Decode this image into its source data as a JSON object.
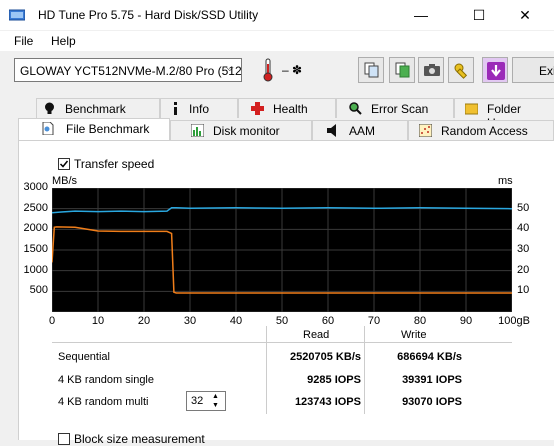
{
  "window": {
    "title": "HD Tune Pro 5.75 - Hard Disk/SSD Utility",
    "minimize": "—",
    "maximize": "☐",
    "close": "✕"
  },
  "menu": {
    "items": [
      "File",
      "Help"
    ]
  },
  "toolbar": {
    "drive": "GLOWAY YCT512NVMe-M.2/80 Pro (512",
    "temperature": "– ✽",
    "exit_label": "Exi"
  },
  "tabs_row1": [
    "Benchmark",
    "Info",
    "Health",
    "Error Scan",
    "Folder Usage"
  ],
  "tabs_row2": [
    "File Benchmark",
    "Disk monitor",
    "AAM",
    "Random Access"
  ],
  "transfer_speed_label": "Transfer speed",
  "chart_data": {
    "type": "line",
    "left_unit": "MB/s",
    "right_unit": "ms",
    "y_left_ticks": [
      "3000",
      "2500",
      "2000",
      "1500",
      "1000",
      "500"
    ],
    "y_right_ticks": [
      "50",
      "40",
      "30",
      "20",
      "10"
    ],
    "x_ticks": [
      "0",
      "10",
      "20",
      "30",
      "40",
      "50",
      "60",
      "70",
      "80",
      "90",
      "100gB"
    ],
    "ylim_left": [
      0,
      3000
    ],
    "ylim_right": [
      0,
      60
    ],
    "xlim": [
      0,
      100
    ],
    "grid": true,
    "series": [
      {
        "color": "#2aa8e0",
        "axis": "left",
        "x": [
          0,
          2,
          5,
          10,
          15,
          20,
          25,
          26,
          27,
          30,
          40,
          50,
          60,
          70,
          80,
          90,
          100
        ],
        "y": [
          2400,
          2420,
          2440,
          2430,
          2440,
          2430,
          2440,
          2520,
          2520,
          2510,
          2520,
          2510,
          2520,
          2510,
          2520,
          2510,
          2500
        ]
      },
      {
        "color": "#f07e1a",
        "axis": "left",
        "x": [
          0,
          0.5,
          1,
          5,
          10,
          15,
          20,
          25,
          26,
          26.5,
          27,
          30,
          40,
          50,
          60,
          70,
          80,
          90,
          100
        ],
        "y": [
          1200,
          2050,
          2060,
          2050,
          1960,
          1950,
          1950,
          1950,
          1900,
          480,
          460,
          460,
          460,
          460,
          460,
          460,
          460,
          460,
          460
        ]
      }
    ]
  },
  "results": {
    "read_header": "Read",
    "write_header": "Write",
    "rows": [
      {
        "label": "Sequential",
        "read": "2520705 KB/s",
        "write": "686694 KB/s"
      },
      {
        "label": "4 KB random single",
        "read": "9285 IOPS",
        "write": "39391 IOPS"
      },
      {
        "label": "4 KB random multi",
        "read": "123743 IOPS",
        "write": "93070 IOPS"
      }
    ],
    "queue_depth": "32"
  },
  "block_size_label": "Block size measurement",
  "colors": {
    "plot_bg": "#000000",
    "grid": "#3a3a3a",
    "read": "#2aa8e0",
    "write": "#f07e1a"
  }
}
